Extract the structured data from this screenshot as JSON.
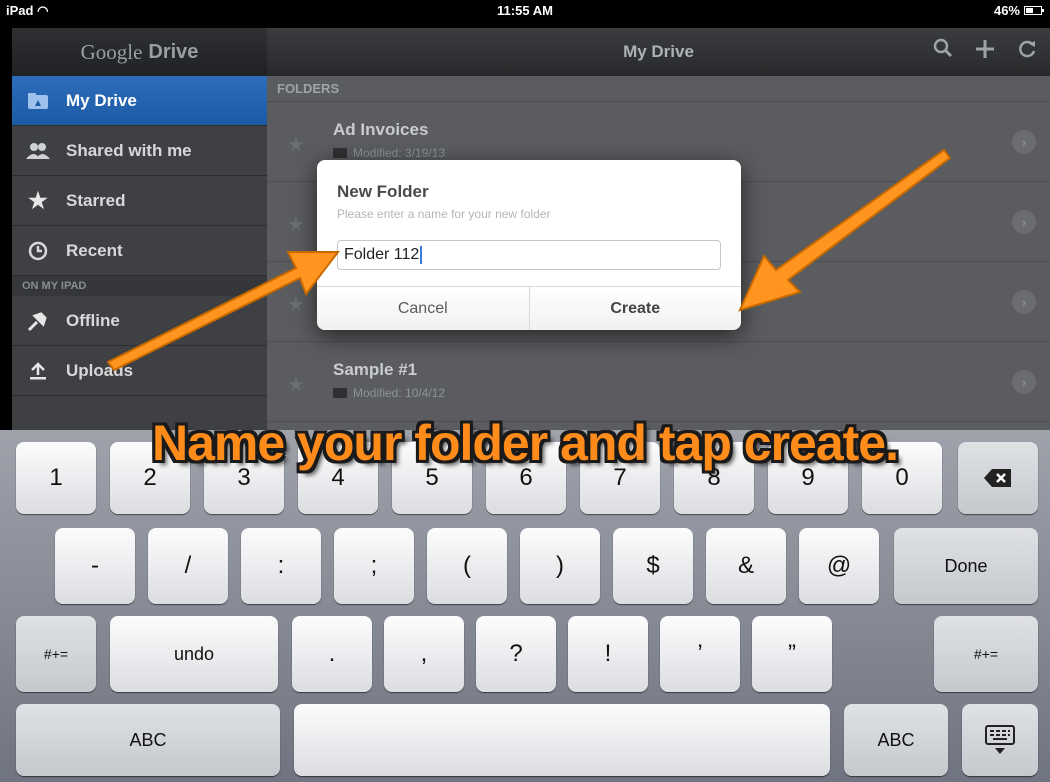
{
  "status_bar": {
    "carrier": "iPad",
    "time": "11:55 AM",
    "battery": "46%"
  },
  "sidebar": {
    "brand_light": "Google",
    "brand_bold": "Drive",
    "items": [
      {
        "label": "My Drive",
        "icon": "drive-icon"
      },
      {
        "label": "Shared with me",
        "icon": "people-icon"
      },
      {
        "label": "Starred",
        "icon": "star-icon"
      },
      {
        "label": "Recent",
        "icon": "clock-icon"
      }
    ],
    "section_label": "ON MY IPAD",
    "local_items": [
      {
        "label": "Offline",
        "icon": "pin-icon"
      },
      {
        "label": "Uploads",
        "icon": "upload-icon"
      }
    ]
  },
  "main": {
    "title": "My Drive",
    "section_label": "FOLDERS",
    "rows": [
      {
        "name": "Ad Invoices",
        "meta": "Modified: 3/19/13"
      },
      {
        "name": "",
        "meta": ""
      },
      {
        "name": "",
        "meta": ""
      },
      {
        "name": "Sample #1",
        "meta": "Modified: 10/4/12"
      }
    ]
  },
  "dialog": {
    "title": "New Folder",
    "subtitle": "Please enter a name for your new folder",
    "input_value": "Folder 112",
    "cancel_label": "Cancel",
    "create_label": "Create"
  },
  "caption": "Name your folder and tap create.",
  "keyboard": {
    "row1": [
      "1",
      "2",
      "3",
      "4",
      "5",
      "6",
      "7",
      "8",
      "9",
      "0"
    ],
    "row2": [
      "-",
      "/",
      ":",
      ";",
      "(",
      ")",
      "$",
      "&",
      "@"
    ],
    "done": "Done",
    "shift_label": "#+=",
    "undo": "undo",
    "row3": [
      ".",
      ",",
      "?",
      "!",
      "’",
      "”"
    ],
    "abc": "ABC"
  },
  "colors": {
    "accent_orange": "#ff8c1a",
    "selected_blue": "#1c5aa6"
  }
}
